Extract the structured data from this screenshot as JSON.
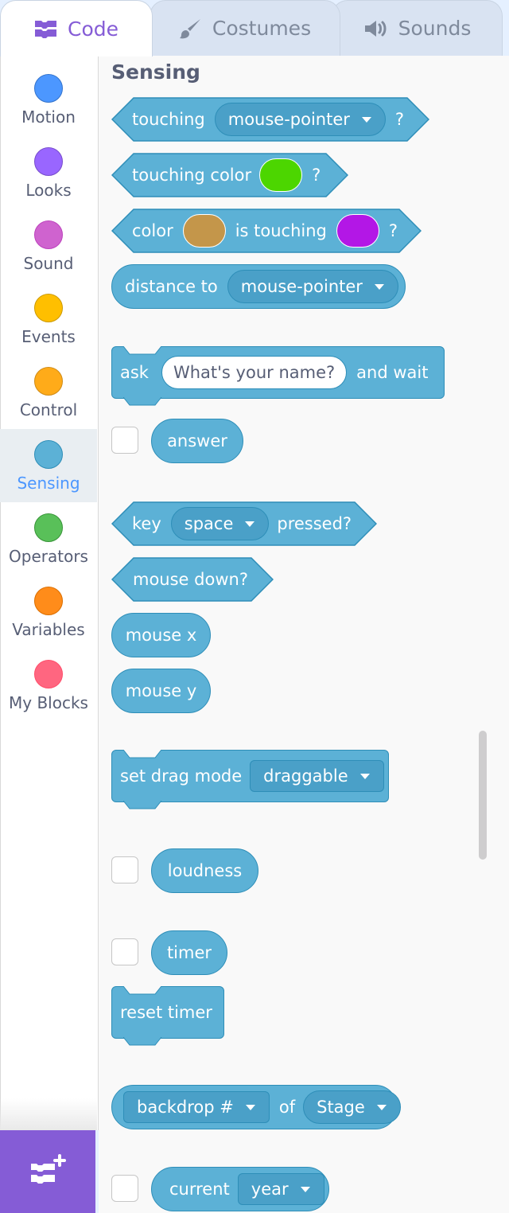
{
  "tabs": {
    "code": "Code",
    "costumes": "Costumes",
    "sounds": "Sounds"
  },
  "categories": [
    {
      "label": "Motion",
      "color": "#4c97ff",
      "border": "#3373cc"
    },
    {
      "label": "Looks",
      "color": "#9966ff",
      "border": "#774dcb"
    },
    {
      "label": "Sound",
      "color": "#cf63cf",
      "border": "#bd42bd"
    },
    {
      "label": "Events",
      "color": "#ffbf00",
      "border": "#cc9900"
    },
    {
      "label": "Control",
      "color": "#ffab19",
      "border": "#cf8b17"
    },
    {
      "label": "Sensing",
      "color": "#5cb1d6",
      "border": "#2e8eb8"
    },
    {
      "label": "Operators",
      "color": "#59c059",
      "border": "#389438"
    },
    {
      "label": "Variables",
      "color": "#ff8c1a",
      "border": "#db6e00"
    },
    {
      "label": "My Blocks",
      "color": "#ff6680",
      "border": "#ff4d6a"
    }
  ],
  "selected_category": "Sensing",
  "palette": {
    "title": "Sensing",
    "touching": {
      "label": "touching",
      "menu": "mouse-pointer",
      "q": "?"
    },
    "touching_color": {
      "label": "touching color",
      "color": "#4cd600",
      "q": "?"
    },
    "color_touching": {
      "label1": "color",
      "color1": "#c4964a",
      "label2": "is touching",
      "color2": "#b317e6",
      "q": "?"
    },
    "distance": {
      "label": "distance to",
      "menu": "mouse-pointer"
    },
    "ask": {
      "label1": "ask",
      "input": "What's your name?",
      "label2": "and wait"
    },
    "answer": {
      "label": "answer"
    },
    "key_pressed": {
      "label1": "key",
      "menu": "space",
      "label2": "pressed?"
    },
    "mouse_down": {
      "label": "mouse down?"
    },
    "mouse_x": {
      "label": "mouse x"
    },
    "mouse_y": {
      "label": "mouse y"
    },
    "drag_mode": {
      "label": "set drag mode",
      "menu": "draggable"
    },
    "loudness": {
      "label": "loudness"
    },
    "timer": {
      "label": "timer"
    },
    "reset_timer": {
      "label": "reset timer"
    },
    "backdrop": {
      "menu1": "backdrop #",
      "label": "of",
      "menu2": "Stage"
    },
    "current": {
      "label": "current",
      "menu": "year"
    }
  }
}
